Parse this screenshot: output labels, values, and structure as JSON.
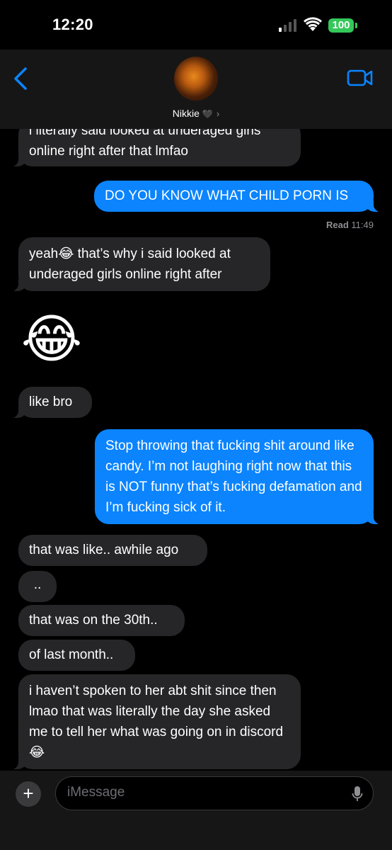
{
  "status": {
    "time": "12:20",
    "battery": "100",
    "battery_color": "#34c759"
  },
  "header": {
    "contact_name": "Nikkie",
    "name_suffix_icon": "black-heart-icon",
    "heart": "🖤",
    "chevron": "›",
    "back_icon": "chevron-left-icon",
    "video_icon": "video-camera-icon",
    "accent": "#0a84ff"
  },
  "messages": [
    {
      "direction": "in",
      "text": "i literally said looked at underaged girls online right after that lmfao"
    },
    {
      "direction": "out",
      "text": "DO YOU KNOW WHAT CHILD PORN IS"
    },
    {
      "direction": "in",
      "text": "yeah😂 that’s why i said looked at underaged girls online right after"
    },
    {
      "direction": "in",
      "text": "😂",
      "emoji_only": true
    },
    {
      "direction": "in",
      "text": "like bro"
    },
    {
      "direction": "out",
      "text": "Stop throwing that fucking shit around like candy. I’m not laughing right now that this is NOT funny that’s fucking defamation and I’m fucking sick of it."
    },
    {
      "direction": "in",
      "text": "that was like.. awhile ago"
    },
    {
      "direction": "in",
      "text": ".."
    },
    {
      "direction": "in",
      "text": "that was on the 30th.."
    },
    {
      "direction": "in",
      "text": "of last month.."
    },
    {
      "direction": "in",
      "text": "i haven’t spoken to her abt shit since then lmao that was literally the day she asked me to tell her what was going on in discord😂"
    }
  ],
  "read_receipt": {
    "label": "Read",
    "time": "11:49"
  },
  "input": {
    "plus": "+",
    "placeholder": "iMessage",
    "mic_icon": "microphone-icon"
  },
  "colors": {
    "outgoing_bubble": "#0b84fe",
    "incoming_bubble": "#262628",
    "background": "#000000"
  }
}
